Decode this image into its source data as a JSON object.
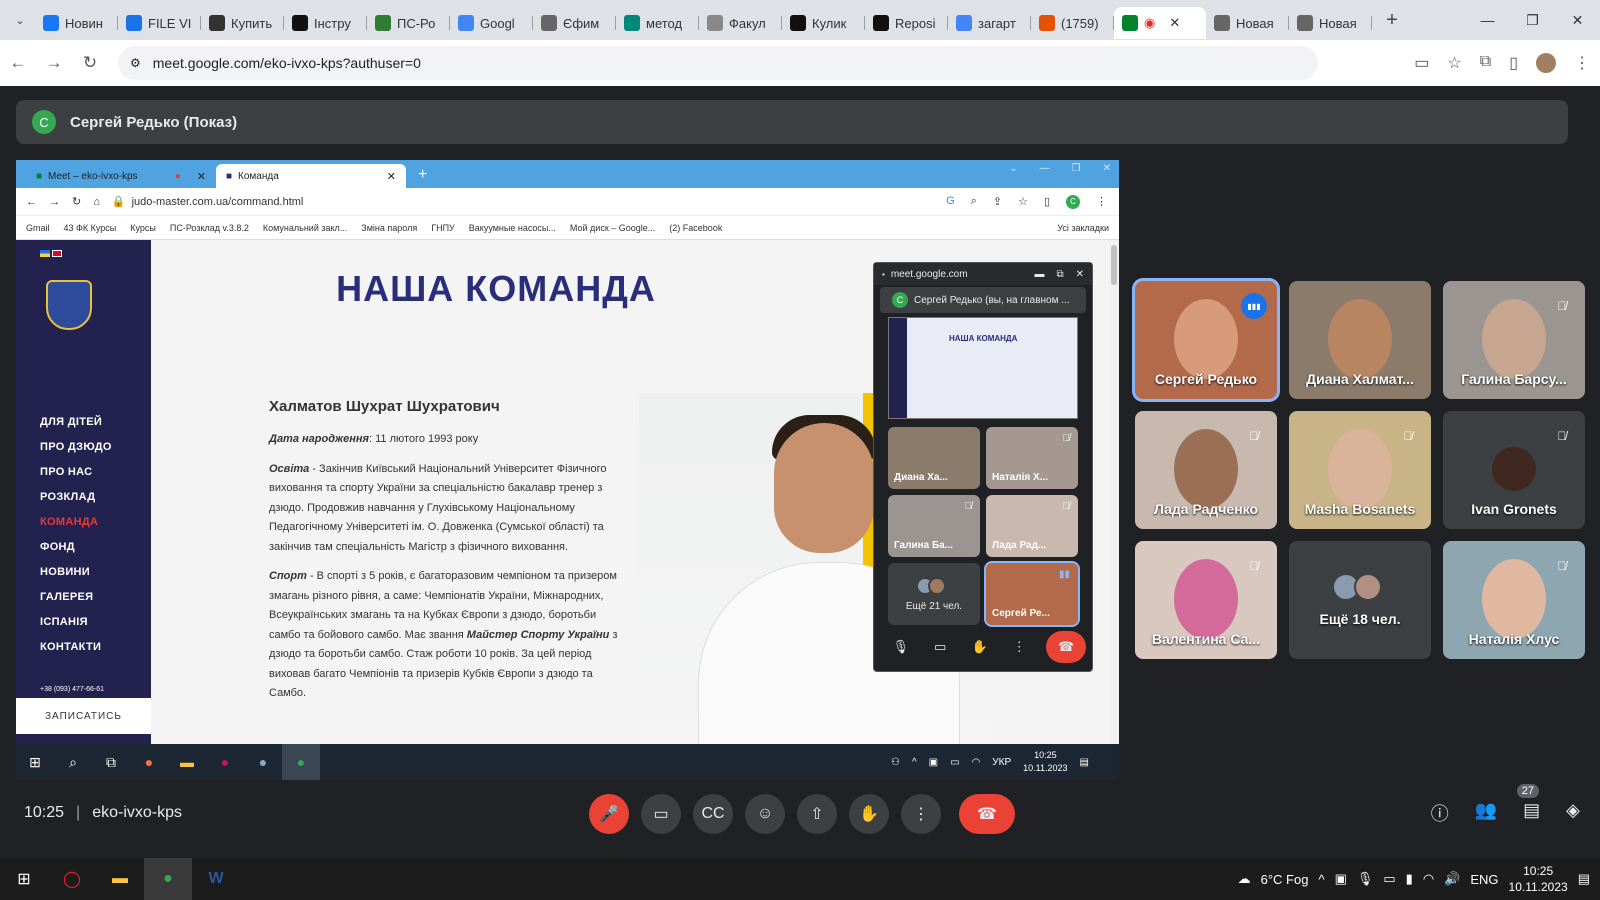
{
  "browser": {
    "tabs": [
      {
        "label": "Новин",
        "icon": "facebook-icon",
        "color": "#1877f2"
      },
      {
        "label": "FILE VI",
        "icon": "file-icon",
        "color": "#1a73e8"
      },
      {
        "label": "Купить",
        "icon": "store-icon",
        "color": "#333"
      },
      {
        "label": "Інстру",
        "icon": "w-icon",
        "color": "#111"
      },
      {
        "label": "ПС-Ро",
        "icon": "ps-icon",
        "color": "#2e7d32"
      },
      {
        "label": "Googl",
        "icon": "translate-icon",
        "color": "#4285f4"
      },
      {
        "label": "Єфим",
        "icon": "mountain-icon",
        "color": "#666"
      },
      {
        "label": "метод",
        "icon": "ok-icon",
        "color": "#00897b"
      },
      {
        "label": "Факул",
        "icon": "globe-icon",
        "color": "#888"
      },
      {
        "label": "Кулик",
        "icon": "d-icon",
        "color": "#111"
      },
      {
        "label": "Reposi",
        "icon": "d-icon",
        "color": "#111"
      },
      {
        "label": "загарт",
        "icon": "google-icon",
        "color": "#4285f4"
      },
      {
        "label": "(1759)",
        "icon": "gift-icon",
        "color": "#e65100"
      },
      {
        "label": "",
        "icon": "meet-icon",
        "color": "#00832d",
        "active": true
      },
      {
        "label": "Новая",
        "icon": "chrome-icon",
        "color": "#666"
      },
      {
        "label": "Новая",
        "icon": "chrome-icon",
        "color": "#666"
      }
    ],
    "url": "meet.google.com/eko-ivxo-kps?authuser=0"
  },
  "meet": {
    "presenter": "Сергей Редько (Показ)",
    "presenter_initial": "С",
    "time": "10:25",
    "meeting_code": "eko-ivxo-kps",
    "participants_count": "27",
    "tiles": [
      {
        "name": "Сергей Редько",
        "muted": false,
        "speaking": true,
        "bg": "#b36a4a",
        "face": "#d79b7a"
      },
      {
        "name": "Диана Халмат...",
        "muted": false,
        "speaking": false,
        "bg": "#8a7b6a",
        "face": "#b88563"
      },
      {
        "name": "Галина Барсу...",
        "muted": true,
        "speaking": false,
        "bg": "#9a9590",
        "face": "#c6a690"
      },
      {
        "name": "Лада Радченко",
        "muted": true,
        "speaking": false,
        "bg": "#c9b8ae",
        "face": "#9b6f56"
      },
      {
        "name": "Masha Bosanets",
        "muted": true,
        "speaking": false,
        "bg": "#c9b488",
        "face": "#d9b39a"
      },
      {
        "name": "Ivan Gronets",
        "muted": true,
        "speaking": false,
        "bg": "#3c4043",
        "face": "#402820"
      },
      {
        "name": "Валентина Са...",
        "muted": true,
        "speaking": false,
        "bg": "#d8c8c0",
        "face": "#d46a9a"
      },
      {
        "name": "Ещё 18 чел.",
        "more": true
      },
      {
        "name": "Наталія Хлус",
        "muted": true,
        "speaking": false,
        "bg": "#8da6b0",
        "face": "#e0b8a0"
      }
    ]
  },
  "shared": {
    "tabs": [
      {
        "label": "Meet – eko-ivxo-kps"
      },
      {
        "label": "Команда"
      }
    ],
    "url": "judo-master.com.ua/command.html",
    "bookmarks": [
      "Gmail",
      "43 ФК Курсы",
      "Курсы",
      "ПС-Розклад v.3.8.2",
      "Комунальний закл...",
      "Зміна пароля",
      "ГНПУ",
      "Вакуумные насосы...",
      "Мой диск – Google...",
      "(2) Facebook"
    ],
    "bookmarks_all": "Усі закладки",
    "site": {
      "flags": "🇺🇦 🇬🇧",
      "menu": [
        "ДЛЯ ДІТЕЙ",
        "ПРО ДЗЮДО",
        "ПРО НАС",
        "РОЗКЛАД",
        "КОМАНДА",
        "ФОНД",
        "НОВИНИ",
        "ГАЛЕРЕЯ",
        "ІСПАНІЯ",
        "КОНТАКТИ"
      ],
      "active_menu": "КОМАНДА",
      "phone": "+38 (093) 477-66-61",
      "signup": "ЗАПИСАТИСЬ",
      "title": "НАША КОМАНДА",
      "person_name": "Халматов Шухрат Шухратович",
      "dob_label": "Дата народження",
      "dob_value": ": 11 лютого 1993 року",
      "edu_label": "Освіта",
      "edu_text": " - Закінчив Київський Національний Університет Фізичного виховання та спорту України за спеціальністю бакалавр тренер з дзюдо. Продовжив навчання у Глухівському Національному Педагогічному Університеті ім. О. Довженка (Сумської області) та закінчив там спеціальність Магістр з фізичного виховання.",
      "sport_label": "Спорт",
      "sport_text": " - В спорті з 5 років, є багаторазовим чемпіоном та призером змагань різного рівня, а саме: Чемпіонатів України, Міжнародних, Всеукраїнських змагань та на Кубках Європи з дзюдо, боротьби самбо та бойового самбо. Має звання ",
      "sport_title": "Майстер Спорту України",
      "sport_text2": " з дзюдо та боротьби самбо. Стаж роботи 10 років. За цей період виховав багато Чемпіонів та призерів Кубків Європи з дзюдо та Самбо."
    },
    "taskbar": {
      "lang": "УКР",
      "time": "10:25",
      "date": "10.11.2023"
    },
    "pip": {
      "domain": "meet.google.com",
      "presenting": "Сергей Редько (вы, на главном ...",
      "mini_title": "НАША КОМАНДА",
      "tiles": [
        {
          "name": "Диана Ха...",
          "muted": false,
          "bg": "#8a7b6a"
        },
        {
          "name": "Наталія Х...",
          "muted": true,
          "bg": "#a59890"
        },
        {
          "name": "Галина Ба...",
          "muted": true,
          "bg": "#9a9590"
        },
        {
          "name": "Лада Рад...",
          "muted": true,
          "bg": "#c9b8ae"
        },
        {
          "name": "Ещё 21 чел.",
          "more": true
        },
        {
          "name": "Сергей Ре...",
          "muted": false,
          "speaking": true,
          "bg": "#b36a4a"
        }
      ]
    }
  },
  "windows": {
    "weather": "6°C  Fog",
    "lang": "ENG",
    "time": "10:25",
    "date": "10.11.2023"
  }
}
